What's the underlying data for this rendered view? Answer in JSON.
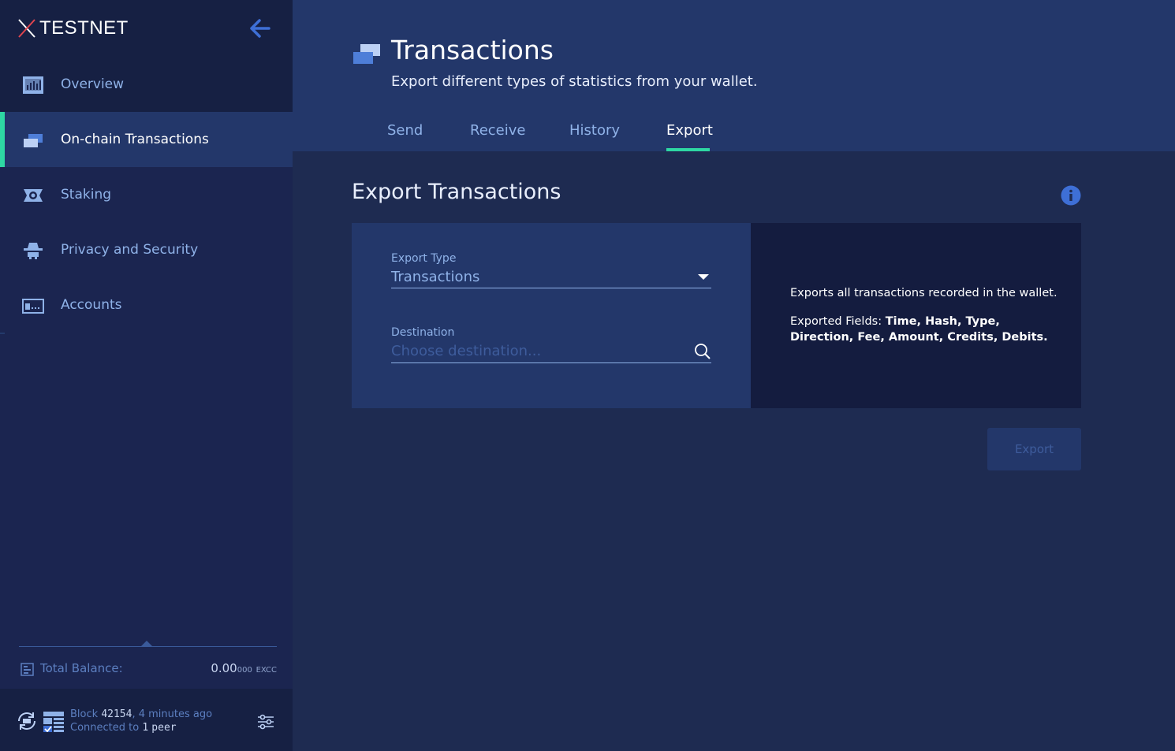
{
  "app": {
    "network_label": "TESTNET"
  },
  "sidebar": {
    "items": [
      {
        "label": "Overview",
        "icon": "overview-icon",
        "active": false
      },
      {
        "label": "On-chain Transactions",
        "icon": "transactions-icon",
        "active": true
      },
      {
        "label": "Staking",
        "icon": "staking-icon",
        "active": false
      },
      {
        "label": "Privacy and Security",
        "icon": "privacy-icon",
        "active": false
      },
      {
        "label": "Accounts",
        "icon": "accounts-icon",
        "active": false
      }
    ],
    "balance": {
      "label": "Total Balance:",
      "value_main": "0.00",
      "value_small": "000",
      "unit": "EXCC"
    },
    "status": {
      "block_label": "Block",
      "block_number": "42154",
      "block_age": ", 4 minutes ago",
      "connected_label": "Connected to",
      "peer_count": "1",
      "peer_word": "peer"
    }
  },
  "header": {
    "title": "Transactions",
    "subtitle": "Export different types of statistics from your wallet.",
    "tabs": [
      {
        "label": "Send",
        "active": false
      },
      {
        "label": "Receive",
        "active": false
      },
      {
        "label": "History",
        "active": false
      },
      {
        "label": "Export",
        "active": true
      }
    ]
  },
  "main": {
    "section_title": "Export Transactions",
    "export_type": {
      "label": "Export Type",
      "value": "Transactions"
    },
    "destination": {
      "label": "Destination",
      "placeholder": "Choose destination..."
    },
    "description": {
      "line1": "Exports all transactions recorded in the wallet.",
      "fields_label": "Exported Fields:",
      "fields_value": "Time, Hash, Type, Direction, Fee, Amount, Credits, Debits."
    },
    "export_button": "Export"
  },
  "colors": {
    "accent": "#2ed8a3",
    "sidebar_bg": "#1b2550",
    "header_bg": "#23376a",
    "content_bg": "#1e2b51",
    "link_blue": "#8fb2e8"
  }
}
